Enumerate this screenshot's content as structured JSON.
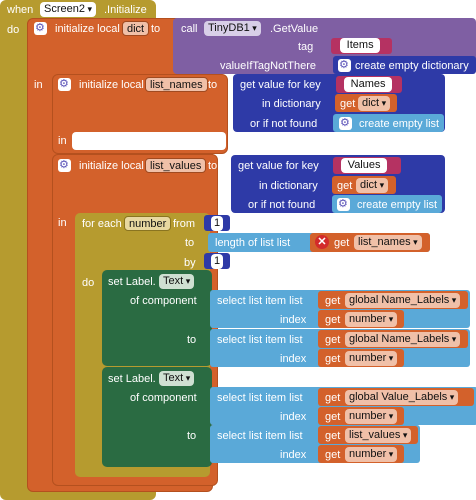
{
  "event": {
    "when": "when",
    "component": "Screen2",
    "event_name": ".Initialize",
    "do": "do"
  },
  "local_dict": {
    "label": "initialize local",
    "var": "dict",
    "to": "to",
    "call": "call",
    "db": "TinyDB1",
    "method": ".GetValue",
    "tag_label": "tag",
    "tag_value": "Items",
    "valueIfTagNotThere_label": "valueIfTagNotThere",
    "default": "create empty dictionary",
    "in": "in"
  },
  "local_list_names": {
    "label": "initialize local",
    "var": "list_names",
    "to": "to",
    "get_value_for_key": "get value for key",
    "key": "Names",
    "in_dictionary": "in dictionary",
    "get": "get",
    "dict_var": "dict",
    "or_if_not_found": "or if not found",
    "default": "create empty list",
    "in": "in"
  },
  "local_list_values": {
    "label": "initialize local",
    "var": "list_values",
    "to": "to",
    "get_value_for_key": "get value for key",
    "key": "Values",
    "in_dictionary": "in dictionary",
    "get": "get",
    "dict_var": "dict",
    "or_if_not_found": "or if not found",
    "default": "create empty list",
    "in": "in"
  },
  "for_each": {
    "label": "for each",
    "var": "number",
    "from": "from",
    "from_val": "1",
    "to": "to",
    "length_label": "length of list  list",
    "get": "get",
    "list_var": "list_names",
    "by": "by",
    "by_val": "1",
    "do": "do"
  },
  "set1": {
    "set": "set Label.",
    "prop": "Text",
    "of_component": "of component",
    "to": "to",
    "select": "select list item  list",
    "index": "index",
    "get": "get",
    "list1": "global Name_Labels",
    "idx1": "number",
    "list2": "global Name_Labels",
    "idx2": "number"
  },
  "set2": {
    "set": "set Label.",
    "prop": "Text",
    "of_component": "of component",
    "to": "to",
    "select": "select list item  list",
    "index": "index",
    "get": "get",
    "list1": "global Value_Labels",
    "idx1": "number",
    "list2": "list_values",
    "idx2": "number"
  },
  "colors": {
    "event": "#b69b2f",
    "local": "#d3612b",
    "db": "#7f5fa3",
    "text": "#b53262",
    "proc": "#5a52b8",
    "dict": "#2e3aa7",
    "list": "#5aa9d8",
    "comp": "#2a6b42",
    "loop": "#b69b2f"
  }
}
